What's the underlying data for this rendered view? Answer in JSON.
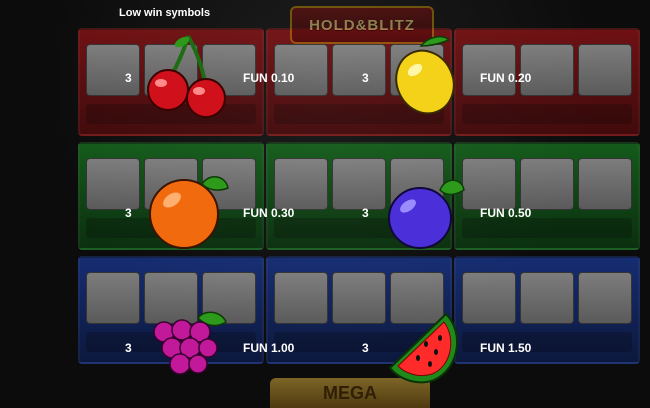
{
  "page": {
    "title": "Low win symbols"
  },
  "background": {
    "logo_text": "HOLD&BLITZ",
    "bottom_text": "MEGA"
  },
  "symbols": [
    {
      "name": "cherry",
      "icon": "cherry-icon",
      "count": "3",
      "payout": "FUN 0.10"
    },
    {
      "name": "lemon",
      "icon": "lemon-icon",
      "count": "3",
      "payout": "FUN 0.20"
    },
    {
      "name": "orange",
      "icon": "orange-icon",
      "count": "3",
      "payout": "FUN 0.30"
    },
    {
      "name": "plum",
      "icon": "plum-icon",
      "count": "3",
      "payout": "FUN 0.50"
    },
    {
      "name": "grapes",
      "icon": "grapes-icon",
      "count": "3",
      "payout": "FUN 1.00"
    },
    {
      "name": "watermelon",
      "icon": "watermelon-icon",
      "count": "3",
      "payout": "FUN 1.50"
    }
  ],
  "colors": {
    "tile_red": "#c0161a",
    "tile_green": "#1c9a27",
    "tile_blue": "#1f48c4",
    "text": "#ffffff"
  }
}
